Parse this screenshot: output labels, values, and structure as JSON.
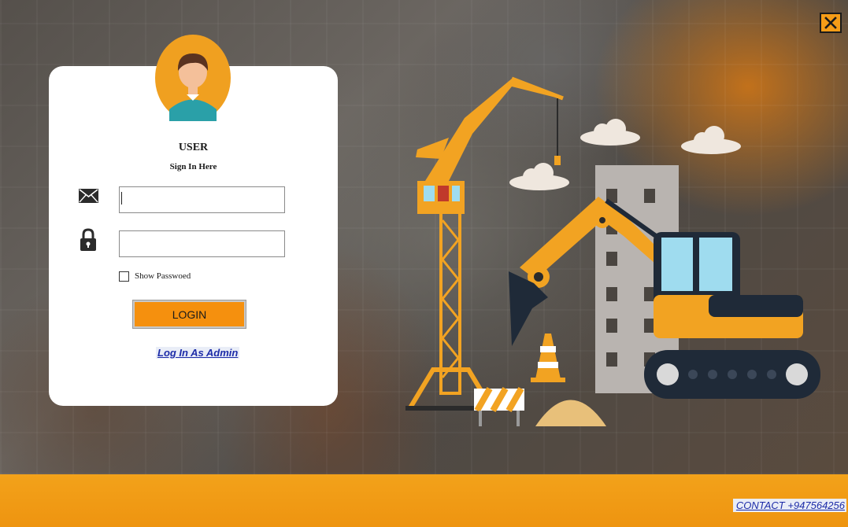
{
  "window": {
    "close_label": "X"
  },
  "login_card": {
    "title": "USER",
    "subtitle": "Sign In Here",
    "email_value": "",
    "password_value": "",
    "show_password_label": "Show Passwoed",
    "show_password_checked": false,
    "login_button": "LOGIN",
    "admin_link": "Log In As Admin"
  },
  "footer": {
    "contact": "CONTACT  +947564256"
  },
  "icons": {
    "close": "close-icon",
    "avatar": "user-avatar-icon",
    "email": "envelope-icon",
    "password": "lock-icon",
    "illustration": "construction-illustration"
  },
  "colors": {
    "accent": "#f5900e",
    "footer": "#f3a21a",
    "card": "#ffffff",
    "link": "#1d2ca8"
  }
}
